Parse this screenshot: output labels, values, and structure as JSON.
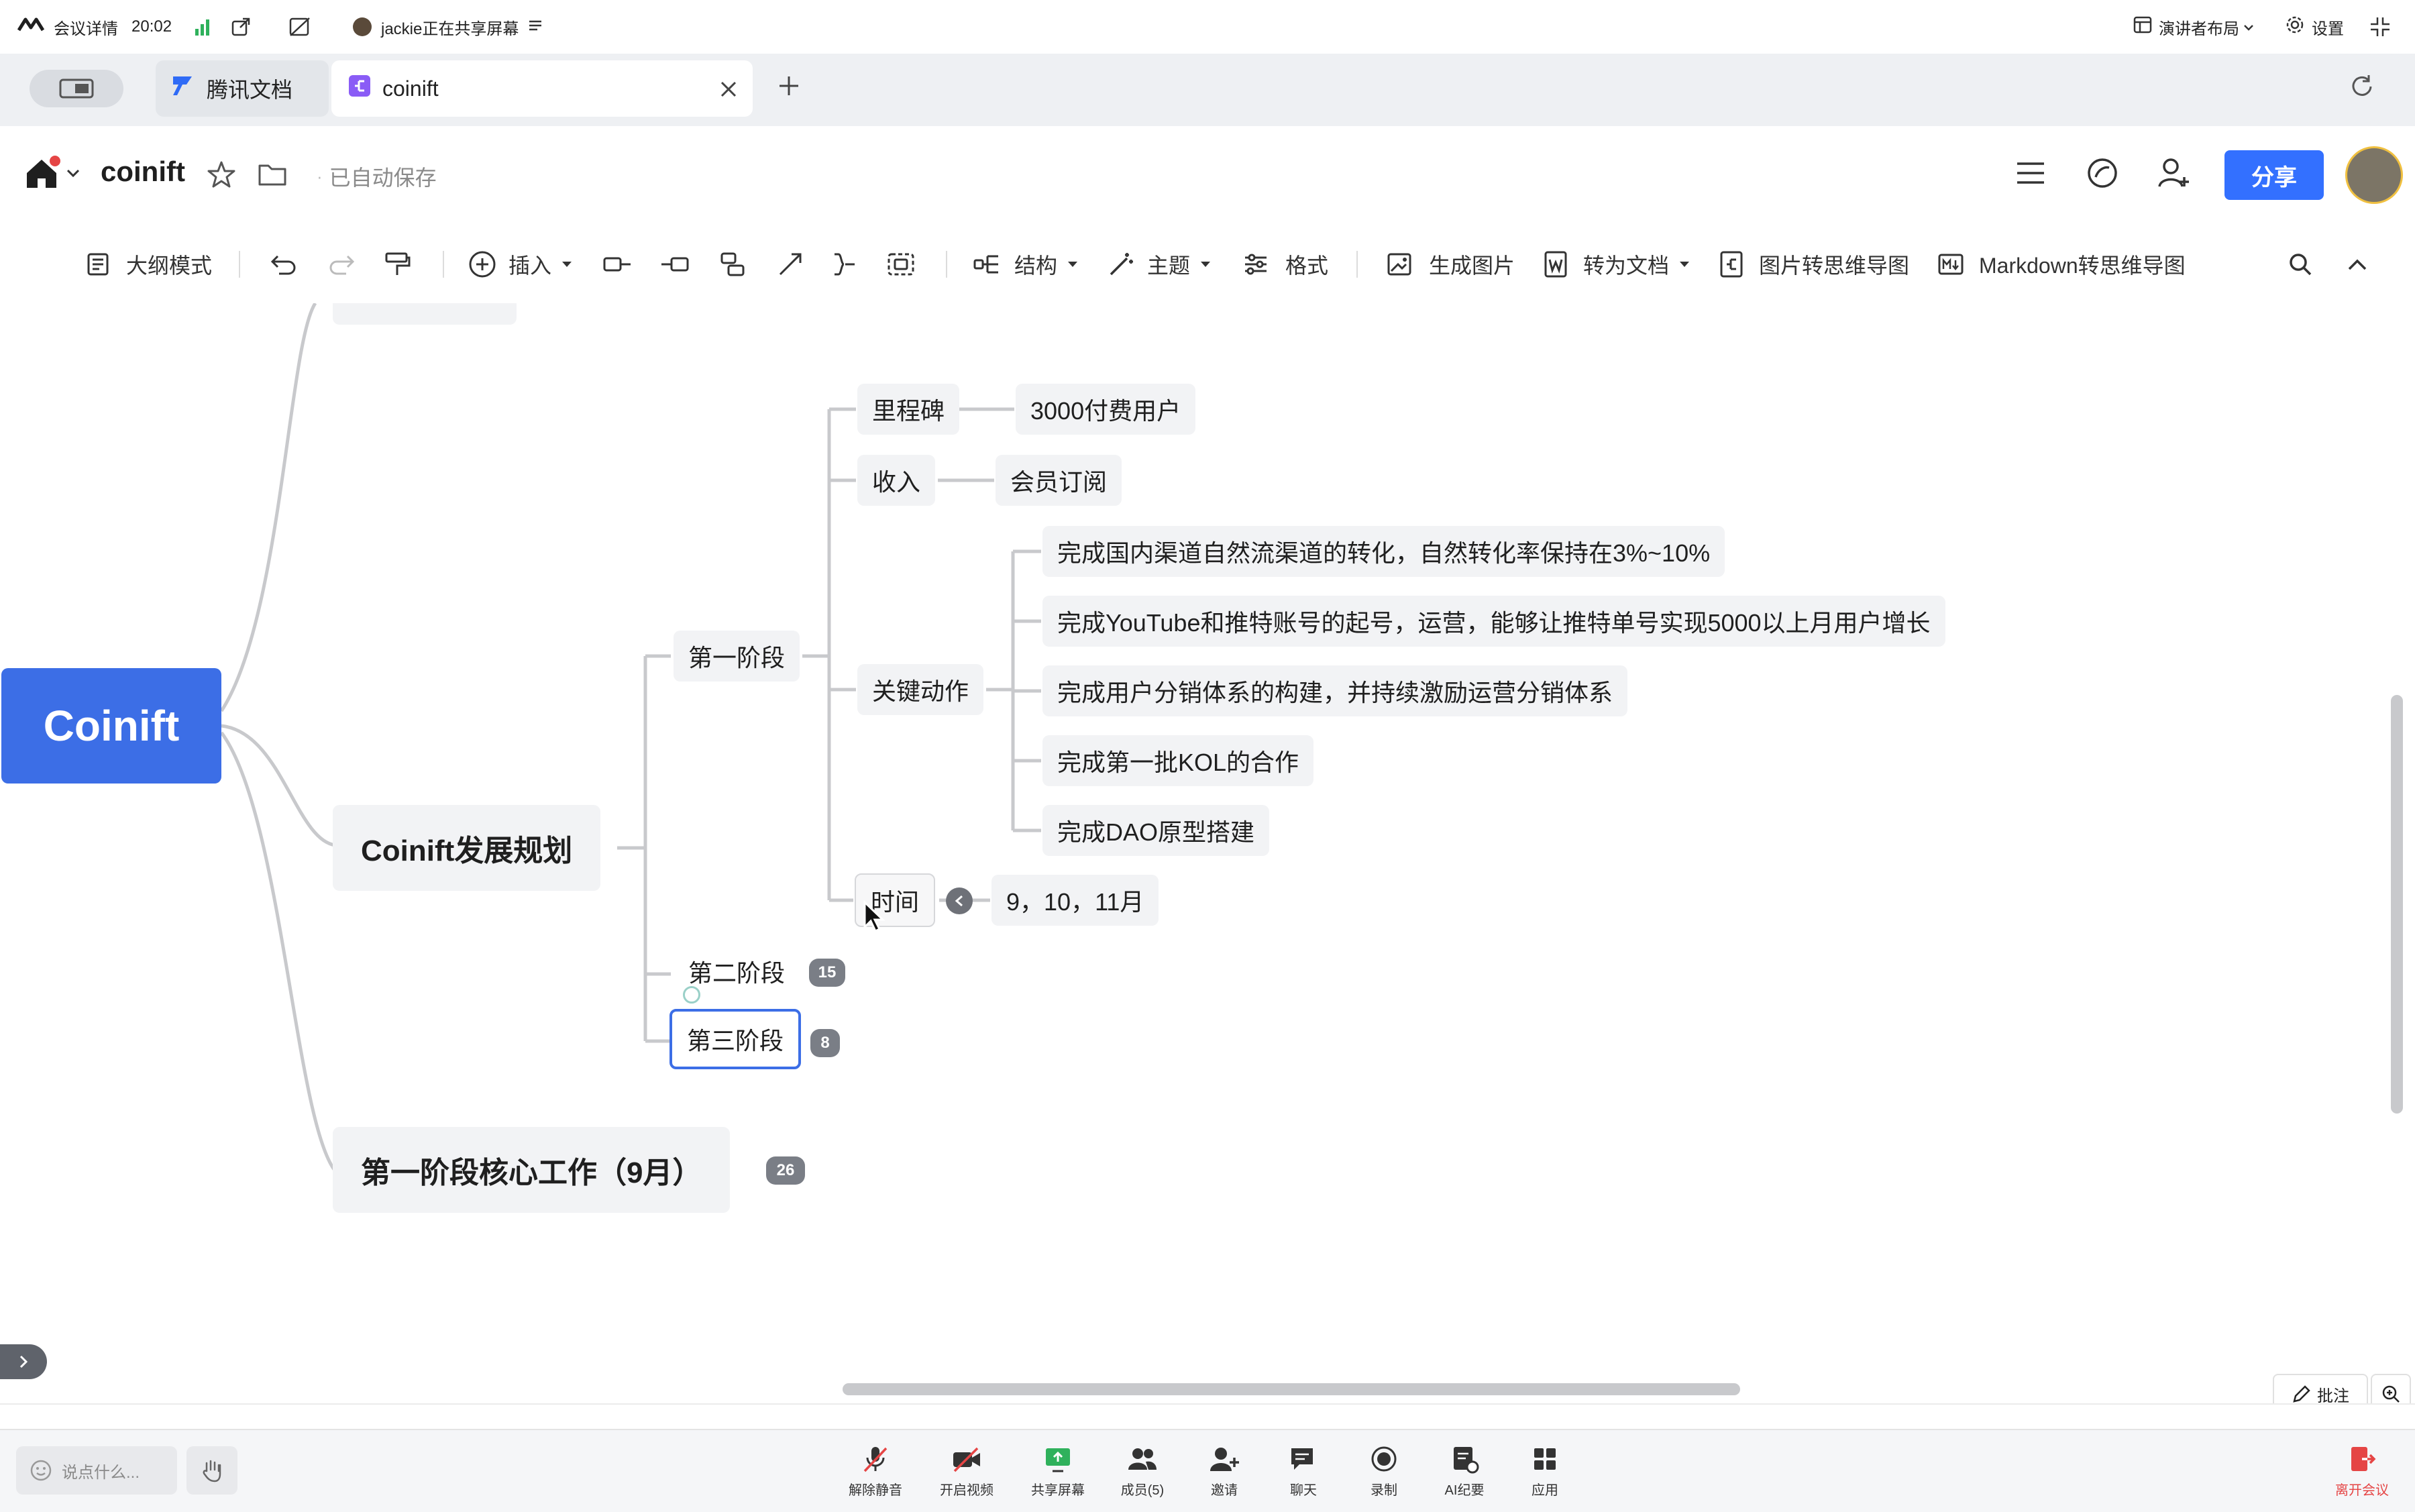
{
  "meeting": {
    "details_label": "会议详情",
    "time": "20:02",
    "sharing_text": "jackie正在共享屏幕",
    "layout_label": "演讲者布局",
    "settings_label": "设置"
  },
  "browser": {
    "tabs": [
      {
        "label": "腾讯文档"
      },
      {
        "label": "coinift"
      }
    ]
  },
  "doc": {
    "title": "coinift",
    "save_status": "已自动保存",
    "share_label": "分享"
  },
  "toolbar": {
    "outline": "大纲模式",
    "insert": "插入",
    "structure": "结构",
    "theme": "主题",
    "format": "格式",
    "gen_image": "生成图片",
    "to_doc": "转为文档",
    "img_to_mindmap": "图片转思维导图",
    "md_to_mindmap": "Markdown转思维导图"
  },
  "mindmap": {
    "root": "Coinift",
    "plan": "Coinift发展规划",
    "core_work": "第一阶段核心工作（9月）",
    "core_work_count": "26",
    "stage1": "第一阶段",
    "stage2": "第二阶段",
    "stage2_count": "15",
    "stage3": "第三阶段",
    "stage3_count": "8",
    "milestone": "里程碑",
    "milestone_value": "3000付费用户",
    "income": "收入",
    "income_value": "会员订阅",
    "key_actions": "关键动作",
    "actions": [
      "完成国内渠道自然流渠道的转化，自然转化率保持在3%~10%",
      "完成YouTube和推特账号的起号，运营，能够让推特单号实现5000以上月用户增长",
      "完成用户分销体系的构建，并持续激励运营分销体系",
      "完成第一批KOL的合作",
      "完成DAO原型搭建"
    ],
    "time_label": "时间",
    "time_value": "9，10，11月"
  },
  "canvas_tools": {
    "annotate": "批注"
  },
  "bottom": {
    "chat_placeholder": "说点什么...",
    "buttons": [
      {
        "label": "解除静音"
      },
      {
        "label": "开启视频"
      },
      {
        "label": "共享屏幕"
      },
      {
        "label": "成员(5)"
      },
      {
        "label": "邀请"
      },
      {
        "label": "聊天"
      },
      {
        "label": "录制"
      },
      {
        "label": "AI纪要"
      },
      {
        "label": "应用"
      }
    ],
    "leave": "离开会议"
  },
  "colors": {
    "accent": "#3370ff",
    "root_fill": "#3c6ee6",
    "node_fill": "#f2f3f5",
    "line": "#c8c9cc",
    "leave_red": "#e54545"
  }
}
